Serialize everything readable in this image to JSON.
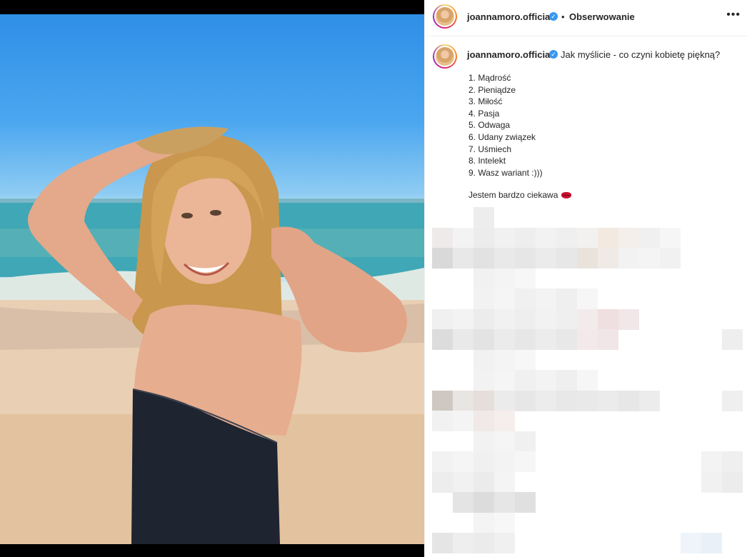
{
  "post": {
    "username": "joannamoro.official",
    "verified": true,
    "separator_dot": "•",
    "follow_label": "Obserwowanie",
    "more_icon": "•••",
    "caption": {
      "username": "joannamoro.official",
      "text": "Jak myślicie - co czyni kobietę piękną?",
      "list": [
        "1. Mądrość",
        "2. Pieniądze",
        "3. Miłość",
        "4. Pasja",
        "5. Odwaga",
        "6. Udany związek",
        "7. Uśmiech",
        "8. Intelekt",
        "9. Wasz wariant :)))"
      ],
      "closing": "Jestem bardzo ciekawa",
      "closing_emoji": "kiss-lips-icon"
    }
  },
  "colors": {
    "verified_blue": "#3897f0",
    "divider": "#efefef",
    "text": "#262626"
  }
}
